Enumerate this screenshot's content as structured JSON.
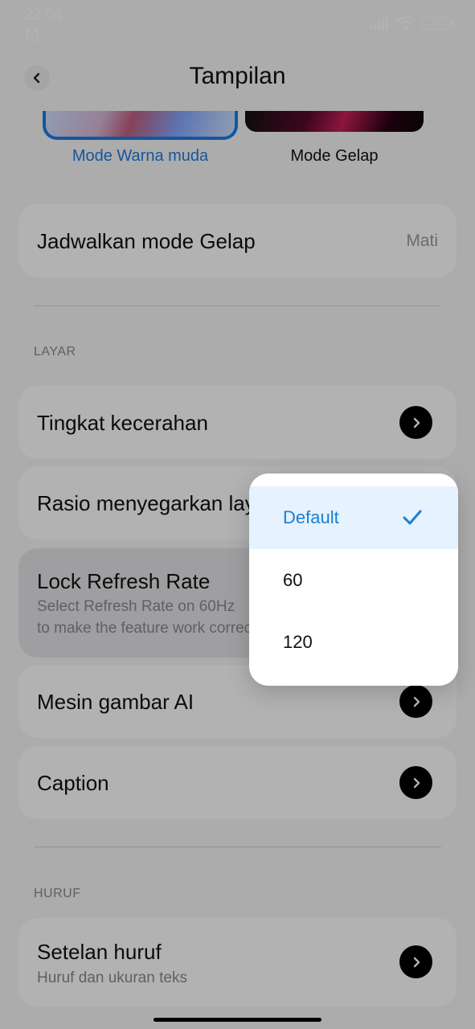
{
  "status": {
    "time": "22:54",
    "battery": "82"
  },
  "header": {
    "title": "Tampilan"
  },
  "theme": {
    "light_label": "Mode Warna muda",
    "dark_label": "Mode Gelap"
  },
  "items": {
    "schedule": {
      "title": "Jadwalkan mode Gelap",
      "value": "Mati"
    },
    "brightness": {
      "title": "Tingkat kecerahan"
    },
    "refresh": {
      "title": "Rasio menyegarkan layar"
    },
    "lock": {
      "title": "Lock Refresh Rate",
      "sub1": "Select Refresh Rate on 60Hz",
      "sub2": "to make the feature work correctly"
    },
    "ai": {
      "title": "Mesin gambar AI"
    },
    "caption": {
      "title": "Caption"
    },
    "font": {
      "title": "Setelan huruf",
      "sub": "Huruf dan ukuran teks"
    }
  },
  "sections": {
    "layar": "LAYAR",
    "huruf": "HURUF"
  },
  "popup": {
    "options": [
      {
        "label": "Default",
        "selected": true
      },
      {
        "label": "60",
        "selected": false
      },
      {
        "label": "120",
        "selected": false
      }
    ]
  },
  "colors": {
    "accent": "#1f7be0",
    "selected_bg": "#e6f2fd",
    "check": "#1a7fd4"
  }
}
